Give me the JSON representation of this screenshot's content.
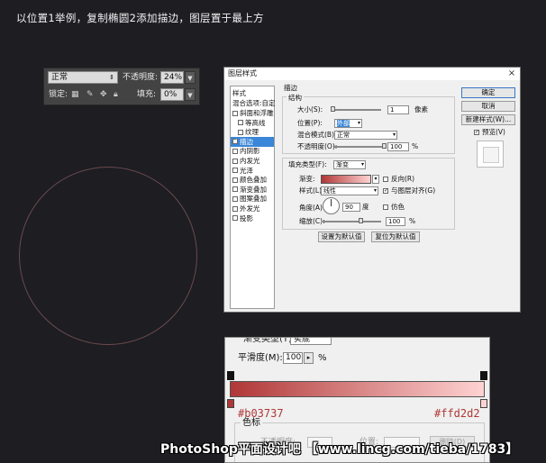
{
  "caption": "以位置1举例，复制椭圆2添加描边，图层置于最上方",
  "layers_panel": {
    "blend_mode": "正常",
    "opacity_label": "不透明度:",
    "opacity_value": "24%",
    "lock_label": "锁定:",
    "fill_label": "填充:",
    "fill_value": "0%"
  },
  "dialog": {
    "title": "图层样式",
    "close": "×",
    "styles_header": "样式",
    "blend_options": "混合选项:自定",
    "style_items": [
      {
        "label": "斜面和浮雕",
        "checked": false,
        "indent": false
      },
      {
        "label": "等高线",
        "checked": false,
        "indent": true
      },
      {
        "label": "纹理",
        "checked": false,
        "indent": true
      },
      {
        "label": "描边",
        "checked": true,
        "indent": false,
        "selected": true
      },
      {
        "label": "内阴影",
        "checked": false,
        "indent": false
      },
      {
        "label": "内发光",
        "checked": false,
        "indent": false
      },
      {
        "label": "光泽",
        "checked": false,
        "indent": false
      },
      {
        "label": "颜色叠加",
        "checked": false,
        "indent": false
      },
      {
        "label": "渐变叠加",
        "checked": false,
        "indent": false
      },
      {
        "label": "图案叠加",
        "checked": false,
        "indent": false
      },
      {
        "label": "外发光",
        "checked": false,
        "indent": false
      },
      {
        "label": "投影",
        "checked": false,
        "indent": false
      }
    ],
    "section_title": "描边",
    "structure_title": "结构",
    "size_label": "大小(S):",
    "size_value": "1",
    "size_unit": "像素",
    "size_fraction": 0.03,
    "position_label": "位置(P):",
    "position_value": "外部",
    "blend_label": "混合模式(B):",
    "blend_value": "正常",
    "opacity_label": "不透明度(O):",
    "opacity_value": "100",
    "opacity_unit": "%",
    "opacity_fraction": 1.0,
    "fill_type_label": "填充类型(F):",
    "fill_type_value": "渐变",
    "gradient_label": "渐变:",
    "reverse_label": "反向(R)",
    "style_label": "样式(L):",
    "style_value": "线性",
    "align_label": "与图层对齐(G)",
    "angle_label": "角度(A):",
    "angle_value": "90",
    "angle_unit": "度",
    "dither_label": "仿色",
    "scale_label": "缩放(C):",
    "scale_value": "100",
    "scale_unit": "%",
    "scale_fraction": 0.66,
    "default_btn": "设置为默认值",
    "reset_btn": "复位为默认值",
    "ok_btn": "确定",
    "cancel_btn": "取消",
    "new_style_btn": "新建样式(W)...",
    "preview_label": "预览(V)"
  },
  "gradient_editor": {
    "partial_label": "渐变类型(T):",
    "partial_value": "实底",
    "smooth_label": "平滑度(M):",
    "smooth_value": "100",
    "smooth_unit": "%",
    "color_left": "#b03737",
    "color_right": "#ffd2d2",
    "color_left_label": "#b03737",
    "color_right_label": "#ffd2d2",
    "stops_title": "色标",
    "stop_opacity_label": "不透明度:",
    "stop_location_label": "位置:",
    "delete_btn": "删除(D)"
  },
  "colors": {
    "background": "#1d1d22",
    "selected_item": "#3a86d8",
    "circle_stroke": "#6b4a4c"
  },
  "icons": [
    "chevron-down-icon",
    "lock-transparent-icon",
    "brush-icon",
    "move-icon",
    "lock-icon",
    "close-icon",
    "angle-dial-icon",
    "arrow-right-icon"
  ],
  "watermark": "PhotoShop平面设计吧 【www.lincg.com/tieba/1783】"
}
